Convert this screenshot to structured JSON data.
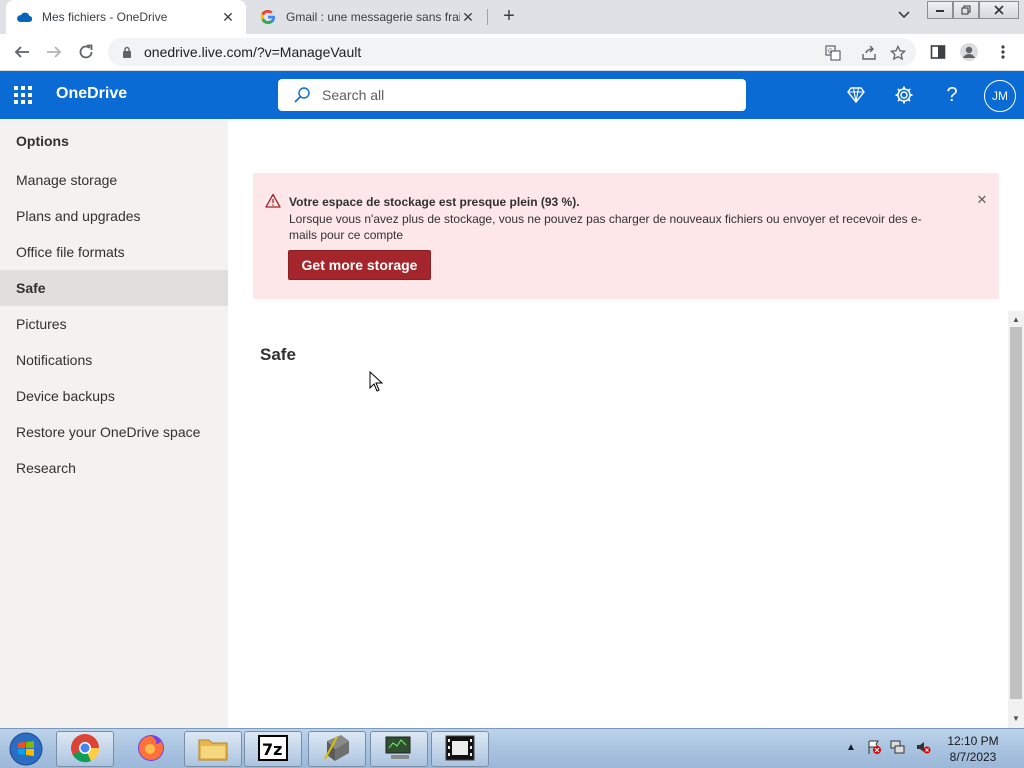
{
  "browser": {
    "tabs": [
      {
        "title": "Mes fichiers - OneDrive",
        "icon": "onedrive-cloud-icon",
        "active": true
      },
      {
        "title": "Gmail : une messagerie sans frais",
        "icon": "google-g-icon",
        "active": false
      }
    ],
    "url": "onedrive.live.com/?v=ManageVault"
  },
  "header": {
    "brand": "OneDrive",
    "search_placeholder": "Search all",
    "avatar_initials": "JM",
    "accent_color": "#0a6bd4"
  },
  "sidebar": {
    "title": "Options",
    "items": [
      {
        "label": "Manage storage"
      },
      {
        "label": "Plans and upgrades"
      },
      {
        "label": "Office file formats"
      },
      {
        "label": "Safe",
        "selected": true
      },
      {
        "label": "Pictures"
      },
      {
        "label": "Notifications"
      },
      {
        "label": "Device backups"
      },
      {
        "label": "Restore your OneDrive space"
      },
      {
        "label": "Research"
      }
    ]
  },
  "banner": {
    "title": "Votre espace de stockage est presque plein (93 %).",
    "message": "Lorsque vous n'avez plus de stockage, vous ne pouvez pas charger de nouveaux fichiers ou envoyer et recevoir des e-mails pour ce compte",
    "button_label": "Get more storage",
    "background_color": "#fde7e9",
    "button_color": "#a4262c"
  },
  "main": {
    "heading": "Safe"
  },
  "taskbar": {
    "apps": [
      "chrome-icon",
      "firefox-icon",
      "file-explorer-icon",
      "7zip-icon",
      "app-icon",
      "monitor-app-icon",
      "film-app-icon"
    ],
    "time": "12:10 PM",
    "date": "8/7/2023"
  }
}
